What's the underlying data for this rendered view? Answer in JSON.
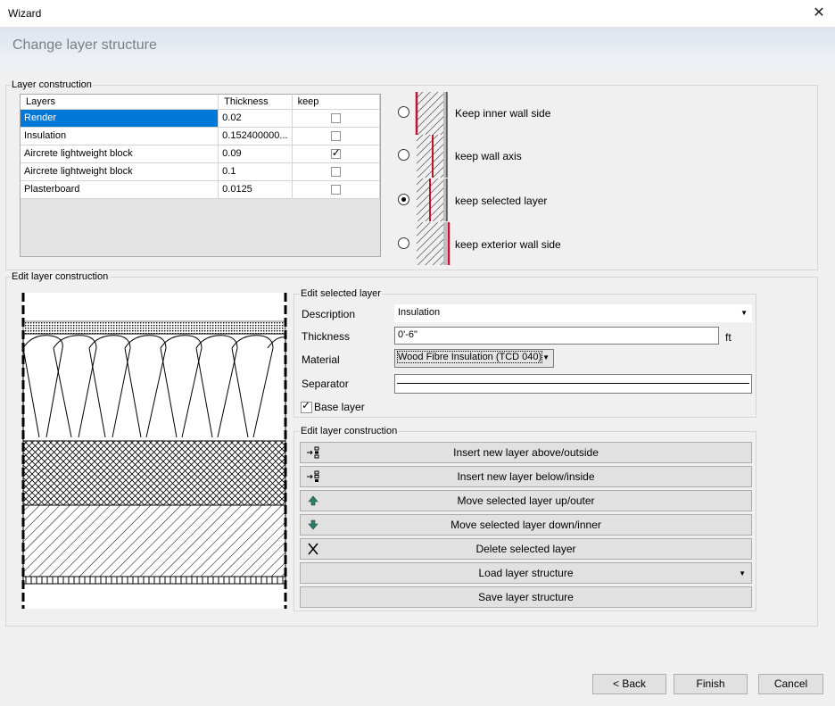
{
  "window": {
    "title": "Wizard",
    "close_glyph": "✕"
  },
  "header": {
    "title": "Change layer structure"
  },
  "layer_construction": {
    "group_label": "Layer construction",
    "columns": [
      "Layers",
      "Thickness",
      "keep"
    ],
    "rows": [
      {
        "name": "Render",
        "thickness": "0.02",
        "keep": false,
        "selected": true
      },
      {
        "name": "Insulation",
        "thickness": "0.152400000...",
        "keep": false,
        "selected": false
      },
      {
        "name": "Aircrete lightweight block",
        "thickness": "0.09",
        "keep": true,
        "selected": false
      },
      {
        "name": "Aircrete lightweight block",
        "thickness": "0.1",
        "keep": false,
        "selected": false
      },
      {
        "name": "Plasterboard",
        "thickness": "0.0125",
        "keep": false,
        "selected": false
      }
    ],
    "options": [
      {
        "label": "Keep inner wall side",
        "selected": false,
        "icon": "wall-keep-inner-icon"
      },
      {
        "label": "keep wall axis",
        "selected": false,
        "icon": "wall-keep-axis-icon"
      },
      {
        "label": "keep selected layer",
        "selected": true,
        "icon": "wall-keep-selected-icon"
      },
      {
        "label": "keep exterior wall side",
        "selected": false,
        "icon": "wall-keep-exterior-icon"
      }
    ]
  },
  "edit_layer_construction": {
    "group_label": "Edit layer construction",
    "selected_layer": {
      "group_label": "Edit selected layer",
      "description_label": "Description",
      "description_value": "Insulation",
      "thickness_label": "Thickness",
      "thickness_value": "0'-6\"",
      "thickness_unit": "ft",
      "material_label": "Material",
      "material_value": "Wood Fibre Insulation (TCD 040)",
      "separator_label": "Separator",
      "base_layer_label": "Base layer",
      "base_layer_checked": true
    },
    "actions": {
      "group_label": "Edit layer construction",
      "insert_above": "Insert new layer above/outside",
      "insert_below": "Insert new layer below/inside",
      "move_up": "Move selected layer up/outer",
      "move_down": "Move selected layer down/inner",
      "delete": "Delete selected layer",
      "load": "Load layer structure",
      "save": "Save layer structure"
    }
  },
  "footer": {
    "back": "< Back",
    "finish": "Finish",
    "cancel": "Cancel"
  },
  "colors": {
    "selection": "#0078d7",
    "accent_red": "#c0142a"
  }
}
